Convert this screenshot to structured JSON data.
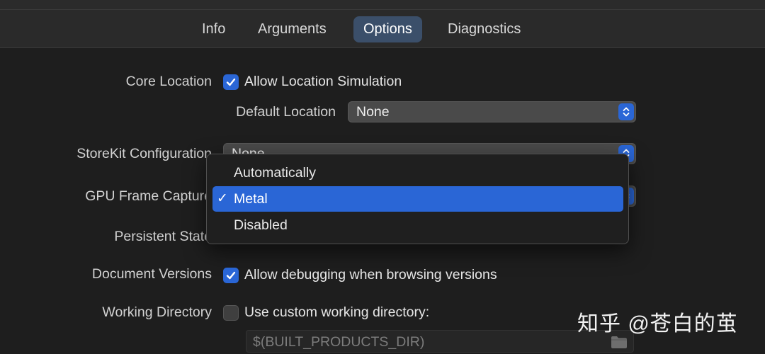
{
  "tabs": [
    {
      "label": "Info",
      "selected": false
    },
    {
      "label": "Arguments",
      "selected": false
    },
    {
      "label": "Options",
      "selected": true
    },
    {
      "label": "Diagnostics",
      "selected": false
    }
  ],
  "core_location": {
    "label": "Core Location",
    "checkbox_label": "Allow Location Simulation",
    "checked": true,
    "default_location_label": "Default Location",
    "default_location_value": "None"
  },
  "storekit": {
    "label": "StoreKit Configuration",
    "value": "None"
  },
  "gpu_frame_capture": {
    "label": "GPU Frame Capture",
    "options": [
      "Automatically",
      "Metal",
      "Disabled"
    ],
    "selected_index": 1,
    "selected_value": "Metal"
  },
  "persistent_state": {
    "label": "Persistent State"
  },
  "document_versions": {
    "label": "Document Versions",
    "checkbox_label": "Allow debugging when browsing versions",
    "checked": true
  },
  "working_directory": {
    "label": "Working Directory",
    "checkbox_label": "Use custom working directory:",
    "checked": false,
    "path_value": "$(BUILT_PRODUCTS_DIR)"
  },
  "watermark": "知乎 @苍白的茧",
  "colors": {
    "accent": "#2a66d6",
    "selected_tab": "#3b4f6a",
    "background": "#1e1e1e"
  }
}
